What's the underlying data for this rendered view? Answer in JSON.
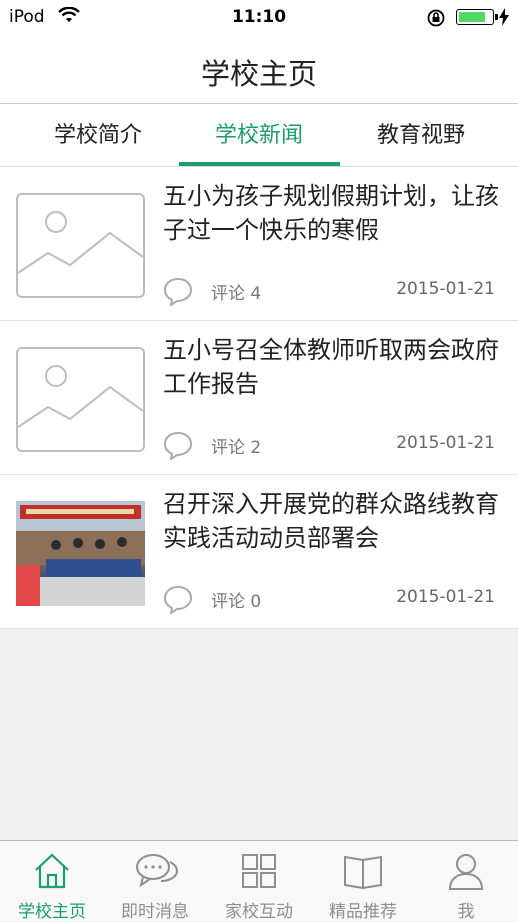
{
  "status_bar": {
    "carrier": "iPod",
    "time": "11:10"
  },
  "nav": {
    "title": "学校主页"
  },
  "tabs": [
    {
      "label": "学校简介"
    },
    {
      "label": "学校新闻"
    },
    {
      "label": "教育视野"
    }
  ],
  "active_tab_index": 1,
  "news": [
    {
      "title": "五小为孩子规划假期计划，让孩子过一个快乐的寒假",
      "comments": "评论 4",
      "date": "2015-01-21",
      "thumbnail": "placeholder"
    },
    {
      "title": "五小号召全体教师听取两会政府工作报告",
      "comments": "评论 2",
      "date": "2015-01-21",
      "thumbnail": "placeholder"
    },
    {
      "title": "召开深入开展党的群众路线教育实践活动动员部署会",
      "comments": "评论 0",
      "date": "2015-01-21",
      "thumbnail": "photo"
    }
  ],
  "tabbar": [
    {
      "label": "学校主页",
      "icon": "house-icon"
    },
    {
      "label": "即时消息",
      "icon": "chat-bubbles-icon"
    },
    {
      "label": "家校互动",
      "icon": "grid-icon"
    },
    {
      "label": "精品推荐",
      "icon": "book-icon"
    },
    {
      "label": "我",
      "icon": "person-icon"
    }
  ],
  "colors": {
    "accent": "#1a9e6a",
    "battery": "#4cd964"
  }
}
